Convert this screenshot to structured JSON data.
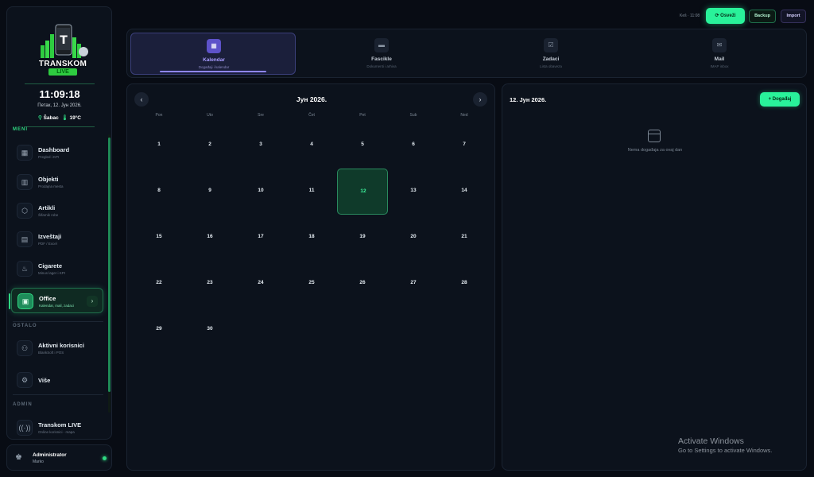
{
  "brand": {
    "name": "TRANSKOM",
    "sub": "LIVE"
  },
  "clock": {
    "time": "11:09:18",
    "date": "Петак, 12. Јун 2026.",
    "city": "Šabac",
    "temp": "19°C"
  },
  "sidebar": {
    "section_menu": "MENI",
    "section_other": "OSTALO",
    "section_admin": "ADMIN",
    "items": [
      {
        "label": "Dashboard",
        "sub": "Pregled i KPI",
        "icon": "dashboard-icon"
      },
      {
        "label": "Objekti",
        "sub": "Prodajna mesta",
        "icon": "building-icon"
      },
      {
        "label": "Artikli",
        "sub": "Šifarnik robe",
        "icon": "box-icon"
      },
      {
        "label": "Izveštaji",
        "sub": "PDF / Excel",
        "icon": "document-icon"
      },
      {
        "label": "Cigarete",
        "sub": "Minus lager i KPI",
        "icon": "flame-icon"
      },
      {
        "label": "Office",
        "sub": "Kalendar, mail, zadaci",
        "icon": "briefcase-icon",
        "active": true
      }
    ],
    "other": [
      {
        "label": "Aktivni korisnici",
        "sub": "BlankSoft i POS",
        "icon": "users-icon"
      },
      {
        "label": "Više",
        "sub": "",
        "icon": "gear-icon"
      }
    ],
    "admin": [
      {
        "label": "Transkom LIVE",
        "sub": "Online korisnici - mapa",
        "icon": "broadcast-icon"
      }
    ]
  },
  "user": {
    "role": "Administrator",
    "name": "Marko"
  },
  "topbar": {
    "cache": "Keš · 11:08",
    "refresh": "Osveži",
    "backup": "Backup",
    "import": "Import"
  },
  "tabs": [
    {
      "label": "Kalendar",
      "sub": "Događaji i kalendar",
      "active": true
    },
    {
      "label": "Fascikle",
      "sub": "Dokumenti i arhiva"
    },
    {
      "label": "Zadaci",
      "sub": "Lista obaveza"
    },
    {
      "label": "Mail",
      "sub": "IMAP inbox"
    }
  ],
  "calendar": {
    "title": "Јун 2026.",
    "weekdays": [
      "Pon",
      "Uto",
      "Sre",
      "Čet",
      "Pet",
      "Sub",
      "Ned"
    ],
    "weeks": [
      [
        "1",
        "2",
        "3",
        "4",
        "5",
        "6",
        "7"
      ],
      [
        "8",
        "9",
        "10",
        "11",
        "12",
        "13",
        "14"
      ],
      [
        "15",
        "16",
        "17",
        "18",
        "19",
        "20",
        "21"
      ],
      [
        "22",
        "23",
        "24",
        "25",
        "26",
        "27",
        "28"
      ],
      [
        "29",
        "30",
        "",
        "",
        "",
        "",
        ""
      ]
    ],
    "today": "12"
  },
  "events": {
    "title": "12. Јун 2026.",
    "add": "Događaj",
    "empty": "Nema događaja za ovaj dan"
  },
  "watermark": {
    "line1": "Activate Windows",
    "line2": "Go to Settings to activate Windows."
  }
}
